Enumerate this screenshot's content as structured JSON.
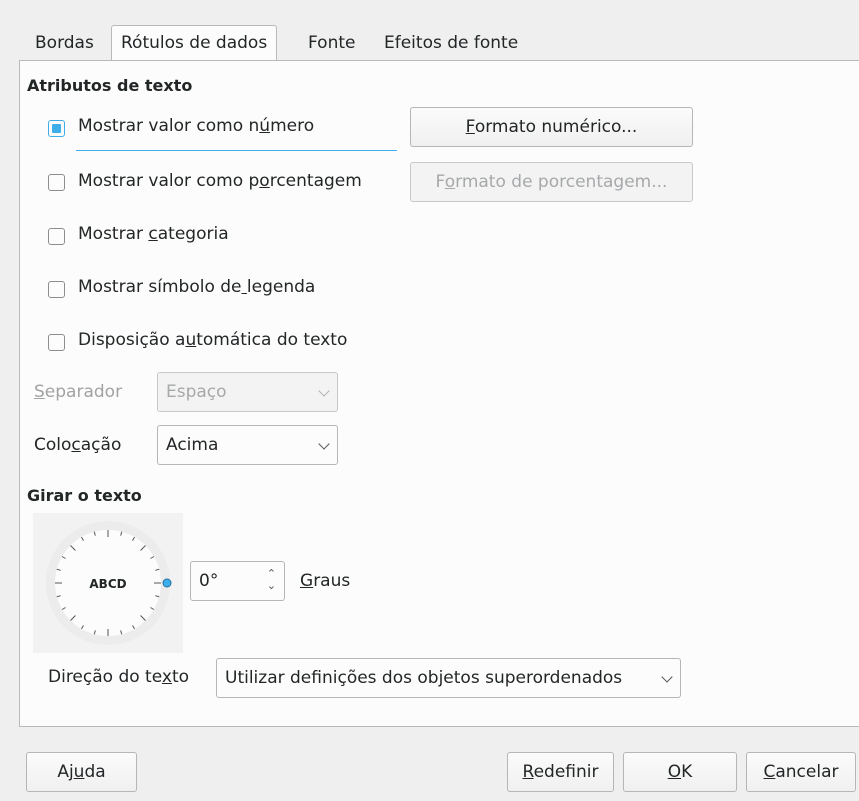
{
  "tabs": [
    {
      "label": "Bordas"
    },
    {
      "label": "Rótulos de dados"
    },
    {
      "label": "Fonte"
    },
    {
      "label": "Efeitos de fonte"
    }
  ],
  "text_attributes": {
    "title": "Atributos de texto",
    "show_value_number": {
      "label": "Mostrar valor como número",
      "checked": true
    },
    "number_format_button": "Formato numérico...",
    "show_value_percent": {
      "label": "Mostrar valor como porcentagem",
      "checked": false
    },
    "percent_format_button": "Formato de porcentagem...",
    "show_category": {
      "label": "Mostrar categoria",
      "checked": false
    },
    "show_legend_symbol": {
      "label": "Mostrar símbolo de legenda",
      "checked": false
    },
    "auto_wrap": {
      "label": "Disposição automática do texto",
      "checked": false
    },
    "separator": {
      "label": "Separador",
      "value": "Espaço"
    },
    "placement": {
      "label": "Colocação",
      "value": "Acima"
    }
  },
  "rotate": {
    "title": "Girar o texto",
    "dial_text": "ABCD",
    "degrees_value": "0°",
    "degrees_label": "Graus",
    "text_direction_label": "Direção do texto",
    "text_direction_value": "Utilizar definições dos objetos superordenados"
  },
  "footer": {
    "help": "Ajuda",
    "reset": "Redefinir",
    "ok": "OK",
    "cancel": "Cancelar"
  },
  "colors": {
    "accent": "#3daee9"
  }
}
